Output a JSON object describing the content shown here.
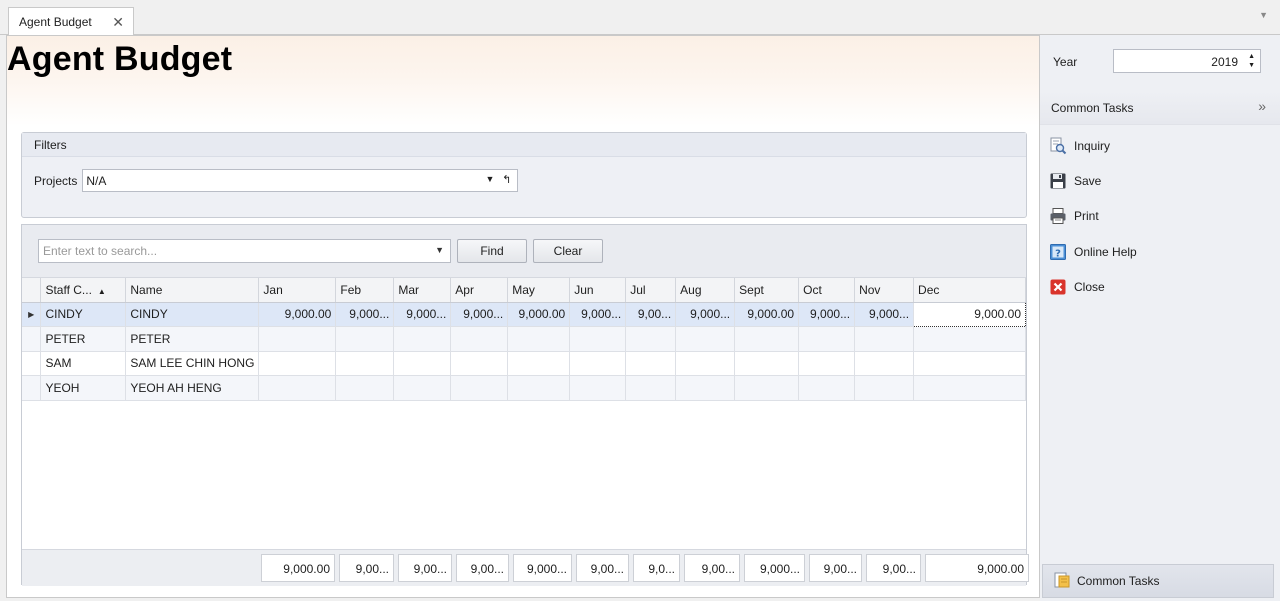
{
  "tab": {
    "label": "Agent Budget",
    "close": "✕"
  },
  "page": {
    "title": "Agent Budget"
  },
  "filters": {
    "header": "Filters",
    "projects_label": "Projects",
    "projects_value": "N/A"
  },
  "search": {
    "placeholder": "Enter text to search...",
    "find_label": "Find",
    "clear_label": "Clear"
  },
  "grid": {
    "columns": [
      "Staff C...",
      "Name",
      "Jan",
      "Feb",
      "Mar",
      "Apr",
      "May",
      "Jun",
      "Jul",
      "Aug",
      "Sept",
      "Oct",
      "Nov",
      "Dec"
    ],
    "rows": [
      {
        "code": "CINDY",
        "name": "CINDY",
        "months": [
          "9,000.00",
          "9,000...",
          "9,000...",
          "9,000...",
          "9,000.00",
          "9,000...",
          "9,00...",
          "9,000...",
          "9,000.00",
          "9,000...",
          "9,000...",
          "9,000.00"
        ]
      },
      {
        "code": "PETER",
        "name": "PETER",
        "months": [
          "",
          "",
          "",
          "",
          "",
          "",
          "",
          "",
          "",
          "",
          "",
          ""
        ]
      },
      {
        "code": "SAM",
        "name": "SAM LEE CHIN HONG",
        "months": [
          "",
          "",
          "",
          "",
          "",
          "",
          "",
          "",
          "",
          "",
          "",
          ""
        ]
      },
      {
        "code": "YEOH",
        "name": "YEOH AH HENG",
        "months": [
          "",
          "",
          "",
          "",
          "",
          "",
          "",
          "",
          "",
          "",
          "",
          ""
        ]
      }
    ],
    "totals": [
      "9,000.00",
      "9,00...",
      "9,00...",
      "9,00...",
      "9,000...",
      "9,00...",
      "9,0...",
      "9,00...",
      "9,000...",
      "9,00...",
      "9,00...",
      "9,000.00"
    ]
  },
  "sidebar": {
    "year_label": "Year",
    "year_value": "2019",
    "common_tasks_label": "Common Tasks",
    "tasks": [
      {
        "label": "Inquiry",
        "icon": "inquiry-icon"
      },
      {
        "label": "Save",
        "icon": "save-icon"
      },
      {
        "label": "Print",
        "icon": "print-icon"
      },
      {
        "label": "Online Help",
        "icon": "help-icon"
      },
      {
        "label": "Close",
        "icon": "close-icon"
      }
    ],
    "bottom_label": "Common Tasks"
  },
  "colors": {
    "selected_row": "#dde7f7",
    "banner": "#fbf0e6",
    "close_icon": "#d9342b"
  }
}
